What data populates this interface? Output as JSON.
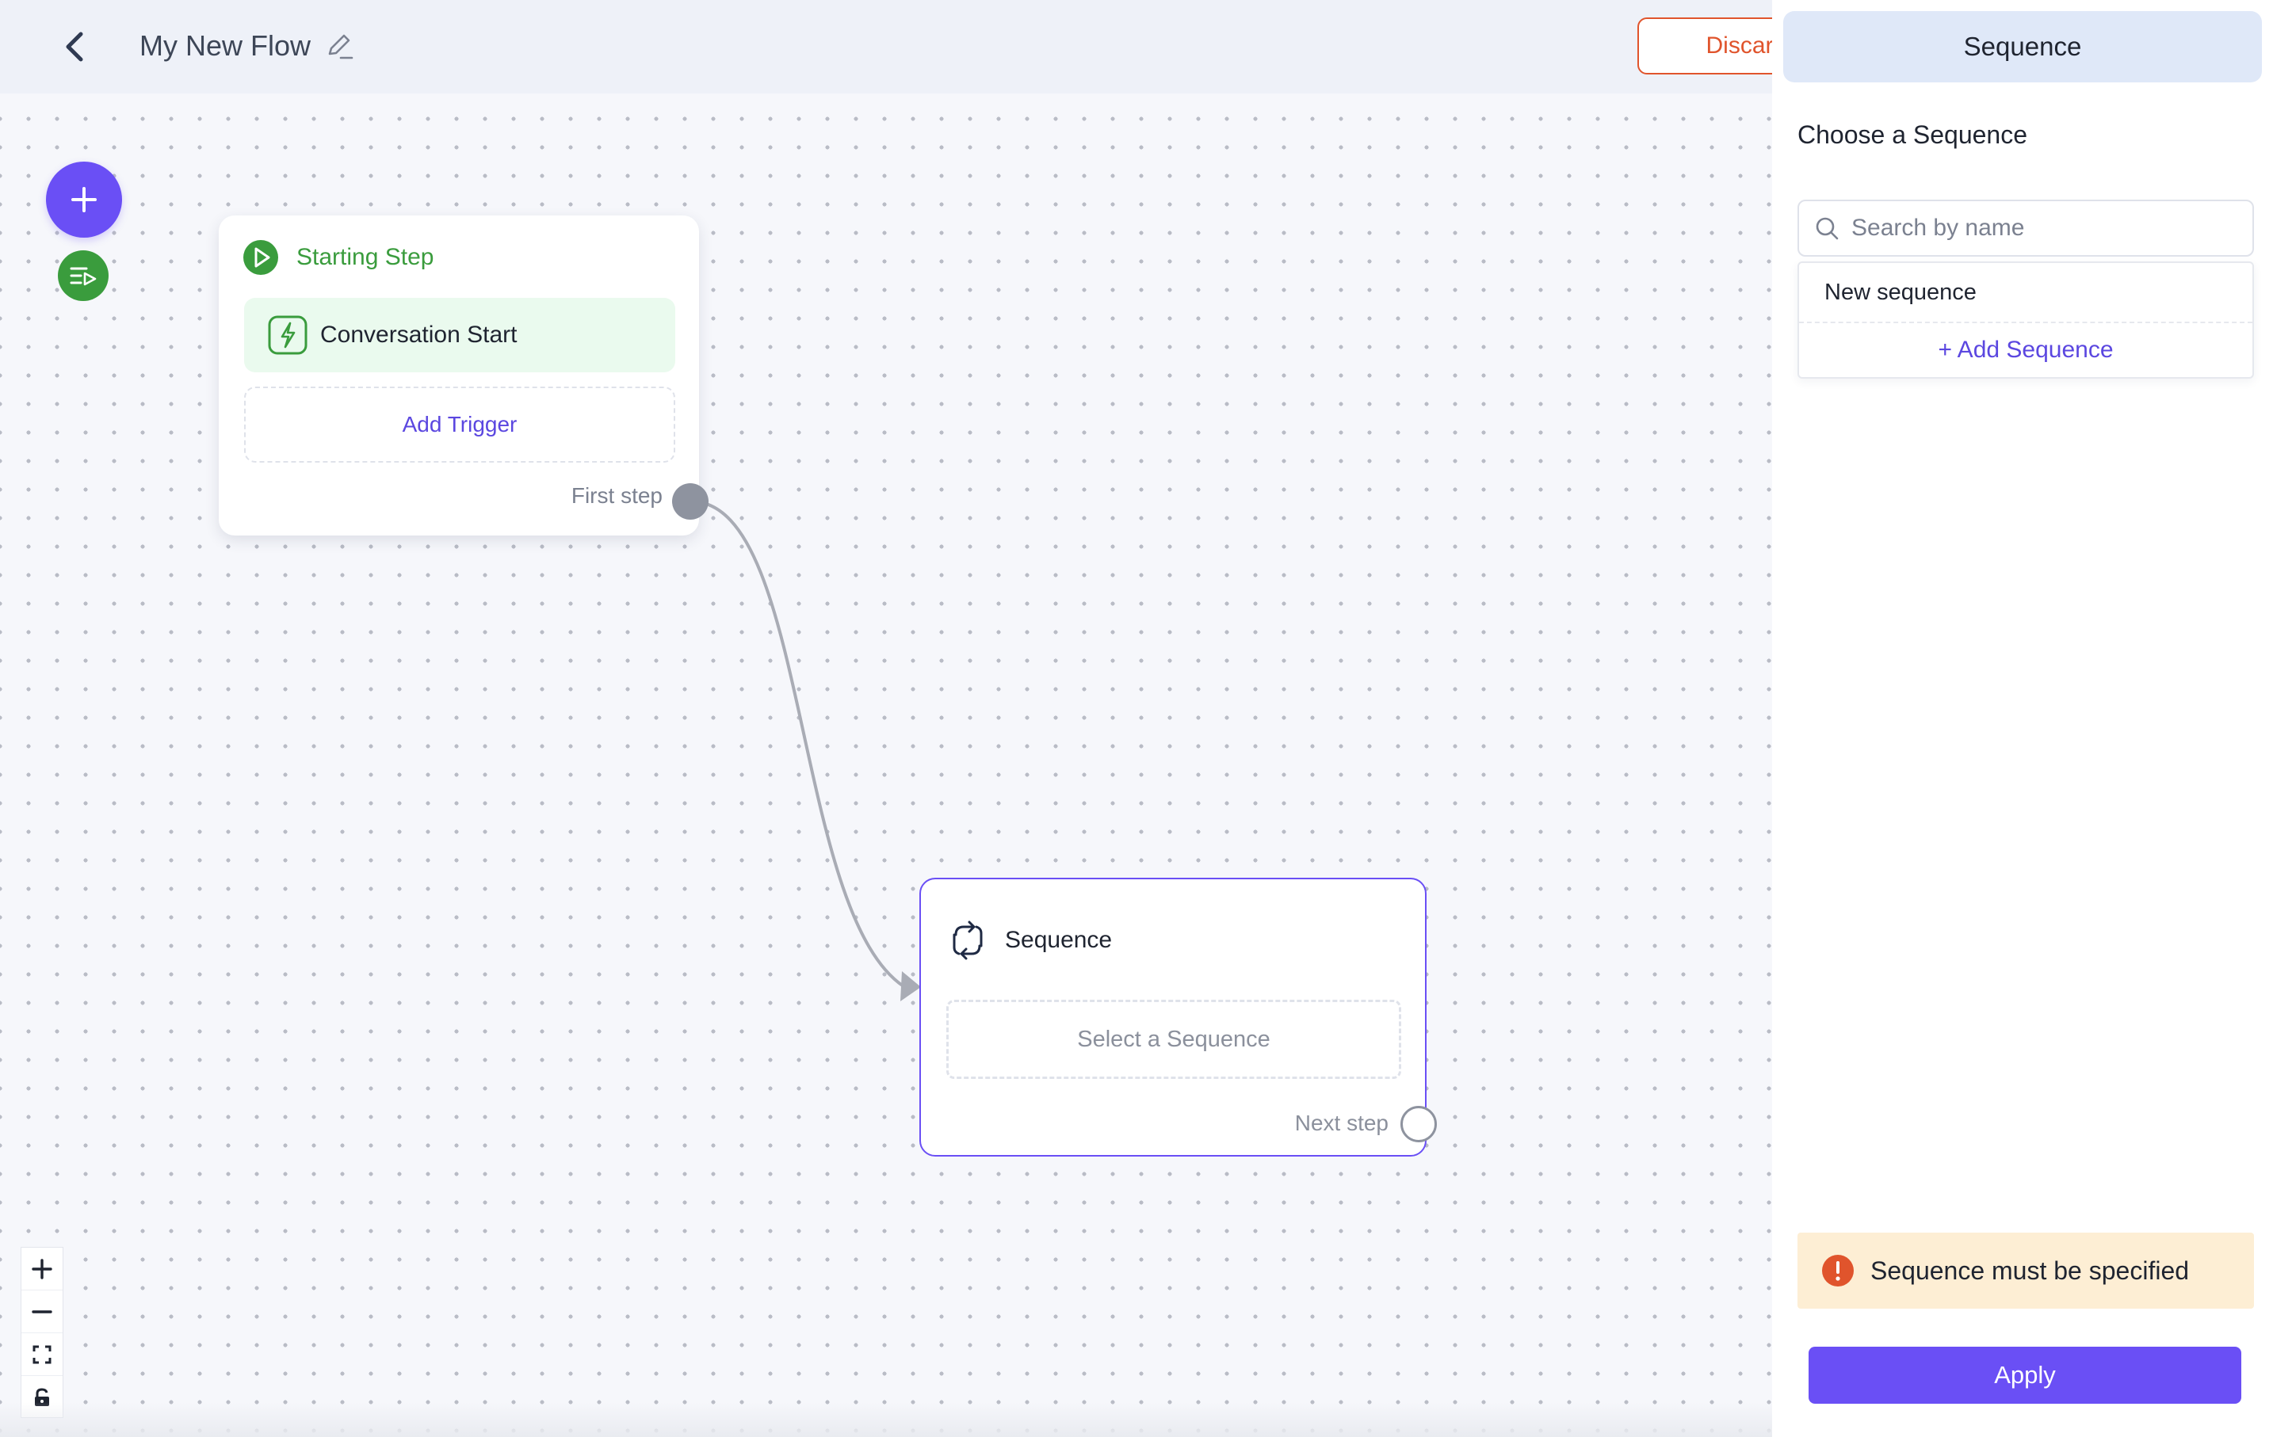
{
  "header": {
    "flow_title": "My New Flow",
    "discard_label": "Discard c"
  },
  "canvas": {
    "start_node": {
      "title": "Starting Step",
      "trigger_label": "Conversation Start",
      "add_trigger_label": "Add Trigger",
      "handle_label": "First step"
    },
    "sequence_node": {
      "title": "Sequence",
      "select_placeholder": "Select a Sequence",
      "handle_label": "Next step"
    }
  },
  "panel": {
    "tab_label": "Sequence",
    "choose_label": "Choose a Sequence",
    "search_placeholder": "Search by name",
    "options": [
      "New sequence"
    ],
    "add_label": "+ Add Sequence",
    "alert_text": "Sequence must be specified",
    "apply_label": "Apply"
  },
  "icons": {
    "back": "chevron-left-icon",
    "edit": "pencil-icon",
    "add": "plus-icon",
    "list": "list-play-icon",
    "start": "play-circle-icon",
    "trigger": "lightning-icon",
    "sequence": "loop-icon",
    "search": "search-icon",
    "alert": "exclamation-circle-icon",
    "zoom_in": "plus-icon",
    "zoom_out": "minus-icon",
    "fit_view": "fit-screen-icon",
    "lock": "lock-icon"
  },
  "colors": {
    "accent": "#6a4ff5",
    "success": "#3a9c3d",
    "danger": "#e0542c",
    "warning_bg": "#fdeed4"
  }
}
